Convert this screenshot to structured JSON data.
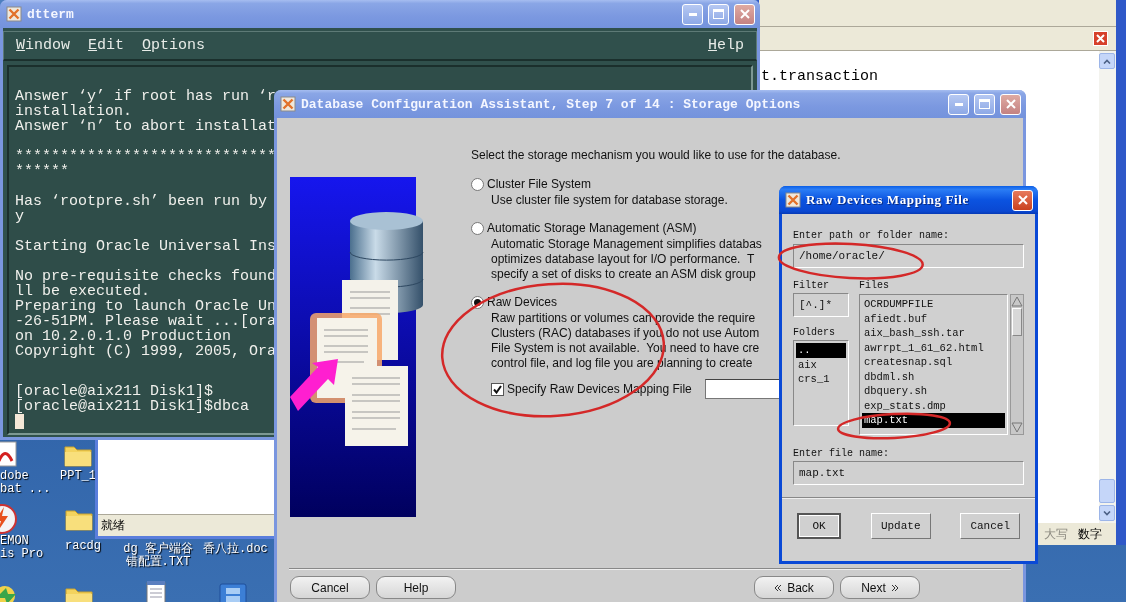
{
  "desktop_icons": [
    {
      "kind": "pdf",
      "label": "dobe\nbat ..."
    },
    {
      "kind": "folder",
      "label": "PPT_1"
    },
    {
      "kind": "daemon",
      "label": "EMON\nis Pro"
    },
    {
      "kind": "folder",
      "label": "racdg"
    },
    {
      "kind": "covered",
      "label": "dg 客户端谷错配置.TXT"
    },
    {
      "kind": "covered",
      "label": "香八拉.doc"
    },
    {
      "kind": "shortcut"
    },
    {
      "kind": "folder"
    },
    {
      "kind": "notepad"
    },
    {
      "kind": "film"
    }
  ],
  "editor_window": {
    "text": "t.transaction",
    "status": [
      {
        "label": "大写",
        "on": false
      },
      {
        "label": "数字",
        "on": true
      }
    ]
  },
  "small_window": {
    "status": "就绪"
  },
  "dtterm": {
    "title": "dtterm",
    "active": false,
    "menu": [
      "Window",
      "Edit",
      "Options"
    ],
    "help_menu": "Help",
    "blocks": [
      [
        "Answer ‘y’ if root has run ‘r",
        "installation.",
        "Answer ‘n’ to abort installat"
      ],
      [
        "*****************************",
        "******"
      ],
      [
        "Has ‘rootpre.sh’ been run by",
        "y"
      ],
      [
        "Starting Oracle Universal Ins"
      ],
      [
        "No pre-requisite checks found",
        "ll be executed.",
        "Preparing to launch Oracle Un",
        "-26-51PM. Please wait ...[ora",
        "on 10.2.0.1.0 Production",
        "Copyright (C) 1999, 2005, Ora"
      ],
      [
        "[oracle@aix211 Disk1]$",
        "[oracle@aix211 Disk1]$dbca"
      ]
    ]
  },
  "dbca": {
    "title": "Database Configuration Assistant, Step 7 of 14 : Storage Options",
    "active": false,
    "prompt": "Select the storage mechanism you would like to use for the database.",
    "options": [
      {
        "label": "Cluster File System",
        "selected": false,
        "description": [
          "Use cluster file system for database storage."
        ]
      },
      {
        "label": "Automatic Storage Management (ASM)",
        "selected": false,
        "description": [
          "Automatic Storage Management simplifies databas",
          "optimizes database layout for I/O performance.  T",
          "specify a set of disks to create an ASM disk group"
        ]
      },
      {
        "label": "Raw Devices",
        "selected": true,
        "description": [
          "Raw partitions or volumes can provide the require",
          "Clusters (RAC) databases if you do not use Autom",
          "File System is not available.  You need to have cre",
          "control file, and log file you are planning to create"
        ],
        "mapping_file": {
          "label": "Specify Raw Devices Mapping File",
          "checked": true
        }
      }
    ],
    "buttons": [
      {
        "label": "Cancel",
        "kind": "plain"
      },
      {
        "label": "Help",
        "kind": "plain"
      },
      {
        "label": "Back",
        "kind": "back"
      },
      {
        "label": "Next",
        "kind": "next"
      }
    ]
  },
  "raw_dialog": {
    "title": "Raw Devices Mapping File",
    "active": true,
    "path_label": "Enter path or folder name:",
    "path": "/home/oracle/",
    "filter_label": "Filter",
    "filter": "[^.]*",
    "folders_label": "Folders",
    "folders": [
      {
        "name": "..",
        "selected": true
      },
      {
        "name": "aix",
        "selected": false
      },
      {
        "name": "crs_1",
        "selected": false
      }
    ],
    "files_label": "Files",
    "files": [
      {
        "name": "OCRDUMPFILE",
        "selected": false
      },
      {
        "name": "afiedt.buf",
        "selected": false
      },
      {
        "name": "aix_bash_ssh.tar",
        "selected": false
      },
      {
        "name": "awrrpt_1_61_62.html",
        "selected": false
      },
      {
        "name": "createsnap.sql",
        "selected": false
      },
      {
        "name": "dbdml.sh",
        "selected": false
      },
      {
        "name": "dbquery.sh",
        "selected": false
      },
      {
        "name": "exp_stats.dmp",
        "selected": false
      },
      {
        "name": "map.txt",
        "selected": true
      }
    ],
    "file_label": "Enter file name:",
    "file_name": "map.txt",
    "buttons": [
      {
        "label": "OK",
        "default": true
      },
      {
        "label": "Update",
        "default": false
      },
      {
        "label": "Cancel",
        "default": false
      }
    ]
  }
}
